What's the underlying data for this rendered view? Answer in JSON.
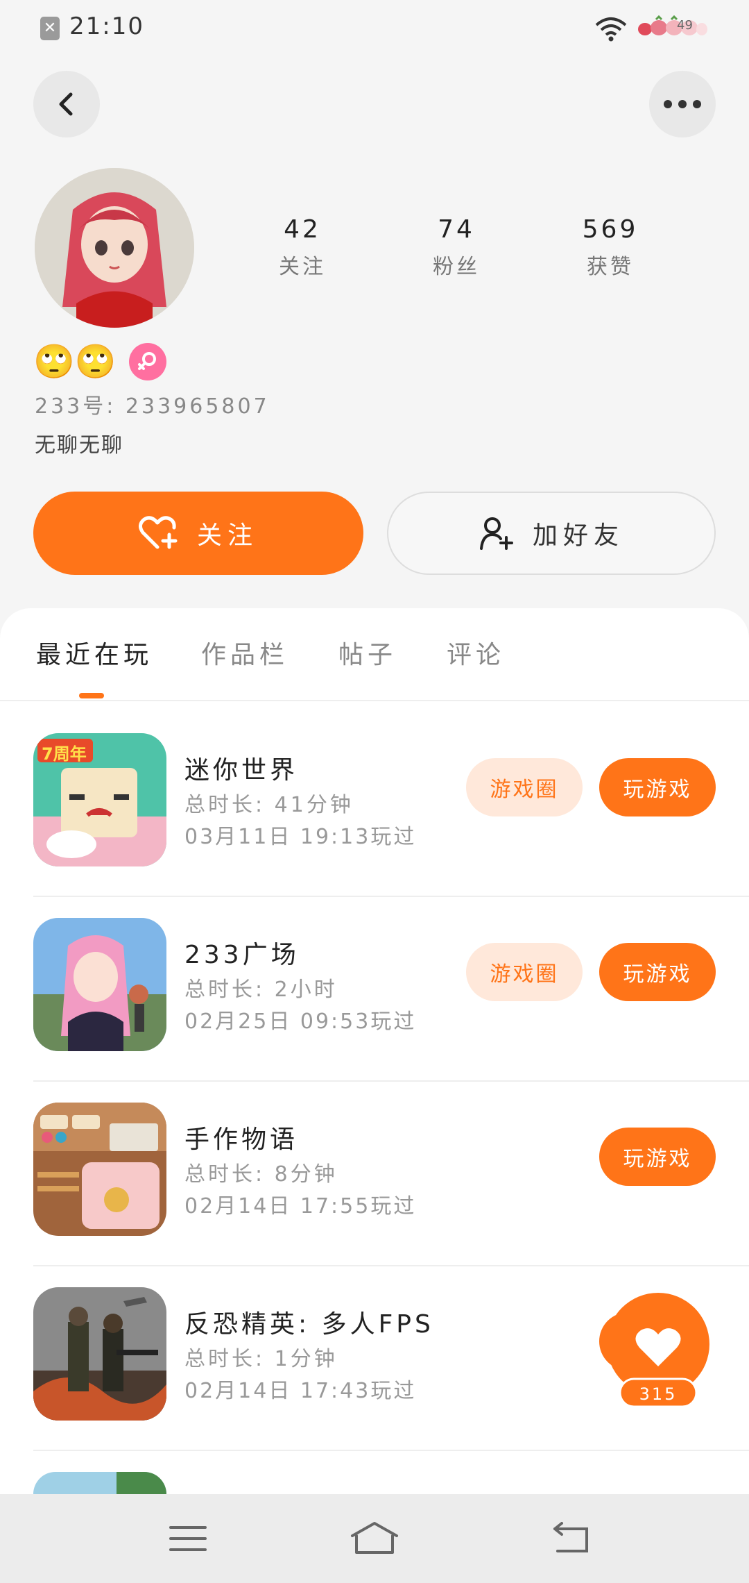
{
  "status_bar": {
    "time": "21:10",
    "sim_icon": "sim-x-icon",
    "battery_level": "49"
  },
  "header": {
    "back_icon": "back-arrow-icon",
    "more_icon": "more-dots-icon"
  },
  "profile": {
    "stats": [
      {
        "value": "42",
        "label": "关注"
      },
      {
        "value": "74",
        "label": "粉丝"
      },
      {
        "value": "569",
        "label": "获赞"
      }
    ],
    "emojis": "🙄🙄",
    "gender_icon": "female-icon",
    "id_line": "233号: 233965807",
    "bio": "无聊无聊"
  },
  "actions": {
    "follow_label": "关注",
    "add_friend_label": "加好友"
  },
  "tabs": [
    {
      "label": "最近在玩",
      "active": true
    },
    {
      "label": "作品栏",
      "active": false
    },
    {
      "label": "帖子",
      "active": false
    },
    {
      "label": "评论",
      "active": false
    }
  ],
  "games": [
    {
      "name": "迷你世界",
      "duration": "总时长: 41分钟",
      "last_played": "03月11日 19:13玩过",
      "circle_label": "游戏圈",
      "play_label": "玩游戏",
      "icon_text": "7周年"
    },
    {
      "name": "233广场",
      "duration": "总时长: 2小时",
      "last_played": "02月25日 09:53玩过",
      "circle_label": "游戏圈",
      "play_label": "玩游戏"
    },
    {
      "name": "手作物语",
      "duration": "总时长: 8分钟",
      "last_played": "02月14日 17:55玩过",
      "circle_label": "",
      "play_label": "玩游戏"
    },
    {
      "name": "反恐精英: 多人FPS",
      "duration": "总时长: 1分钟",
      "last_played": "02月14日 17:43玩过",
      "circle_label": "",
      "play_label": ""
    }
  ],
  "floating_like": {
    "count": "315",
    "icon": "heart-icon"
  },
  "nav_bar": {
    "menu_icon": "menu-icon",
    "home_icon": "home-icon",
    "back_icon": "back-icon"
  },
  "colors": {
    "accent": "#ff7418",
    "accent_light": "#ffe8da",
    "gender_pink": "#ff6fa0"
  }
}
